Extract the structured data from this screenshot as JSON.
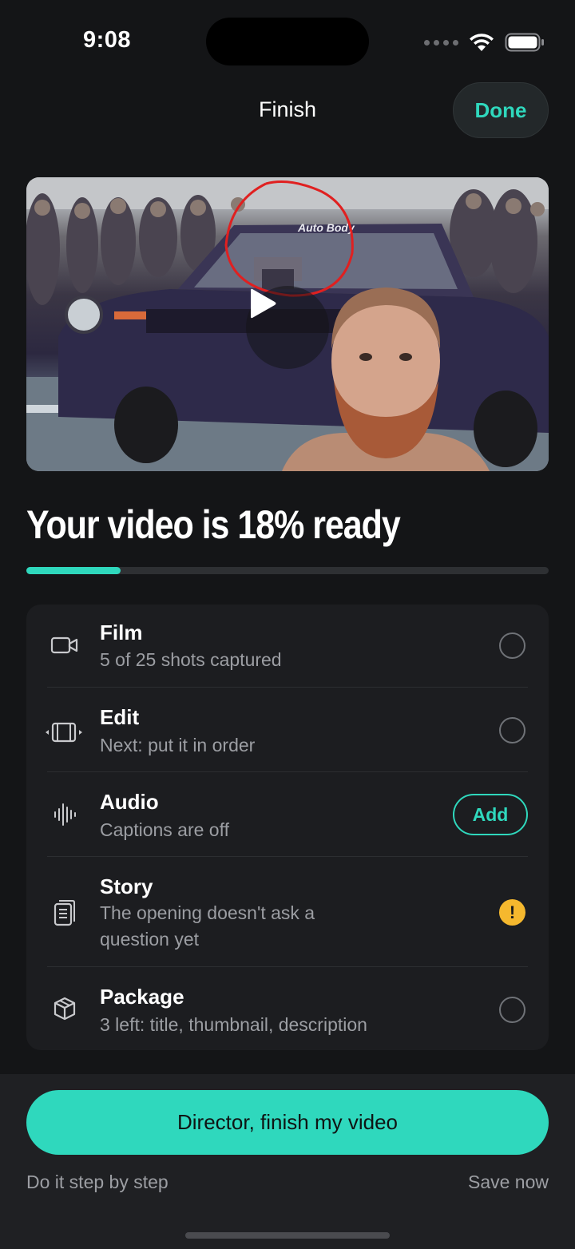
{
  "status_bar": {
    "time": "9:08"
  },
  "nav": {
    "title": "Finish",
    "done_label": "Done"
  },
  "video": {
    "overlay_text": "Auto Body"
  },
  "progress": {
    "heading": "Your video is 18% ready",
    "value_percent": 18
  },
  "checklist": {
    "items": [
      {
        "title": "Film",
        "subtitle": "5 of 25 shots captured",
        "icon": "video-camera-icon",
        "status": "incomplete"
      },
      {
        "title": "Edit",
        "subtitle": "Next: put it in order",
        "icon": "film-strip-icon",
        "status": "incomplete"
      },
      {
        "title": "Audio",
        "subtitle": "Captions are off",
        "icon": "audio-wave-icon",
        "status": "action",
        "action_label": "Add"
      },
      {
        "title": "Story",
        "subtitle": "The opening doesn't ask a question yet",
        "icon": "document-icon",
        "status": "warning"
      },
      {
        "title": "Package",
        "subtitle": "3 left: title, thumbnail, description",
        "icon": "box-icon",
        "status": "incomplete"
      }
    ]
  },
  "footer": {
    "primary_label": "Director, finish my video",
    "secondary_left": "Do it step by step",
    "secondary_right": "Save now"
  },
  "colors": {
    "accent": "#2fd8bd",
    "warning": "#f5b82e",
    "background": "#141517",
    "card": "#1c1d20"
  }
}
